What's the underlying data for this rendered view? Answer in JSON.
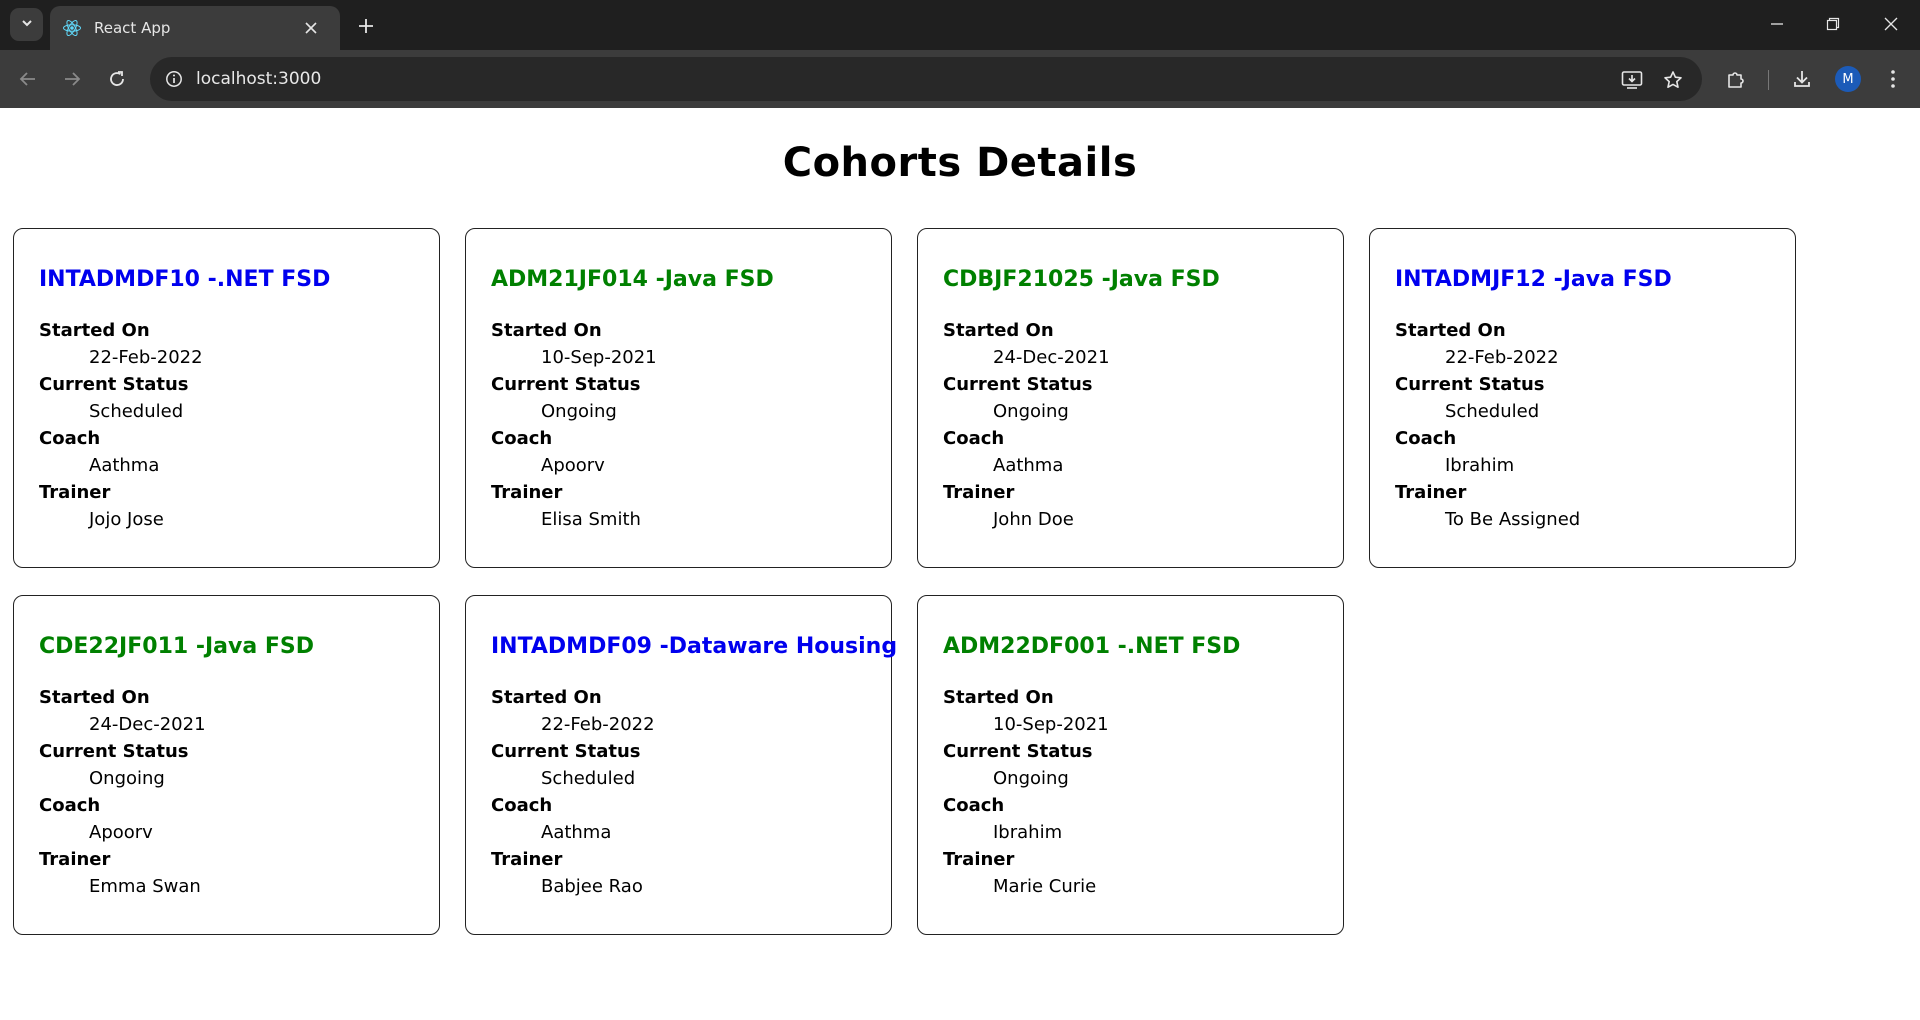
{
  "browser": {
    "tab_title": "React App",
    "url": "localhost:3000",
    "avatar_letter": "M"
  },
  "page": {
    "title": "Cohorts Details"
  },
  "labels": {
    "started_on": "Started On",
    "current_status": "Current Status",
    "coach": "Coach",
    "trainer": "Trainer"
  },
  "colors": {
    "ongoing": "#008000",
    "scheduled": "#0000ee"
  },
  "cohorts": [
    {
      "title": "INTADMDF10 -.NET FSD",
      "started_on": "22-Feb-2022",
      "status": "Scheduled",
      "coach": "Aathma",
      "trainer": "Jojo Jose"
    },
    {
      "title": "ADM21JF014 -Java FSD",
      "started_on": "10-Sep-2021",
      "status": "Ongoing",
      "coach": "Apoorv",
      "trainer": "Elisa Smith"
    },
    {
      "title": "CDBJF21025 -Java FSD",
      "started_on": "24-Dec-2021",
      "status": "Ongoing",
      "coach": "Aathma",
      "trainer": "John Doe"
    },
    {
      "title": "INTADMJF12 -Java FSD",
      "started_on": "22-Feb-2022",
      "status": "Scheduled",
      "coach": "Ibrahim",
      "trainer": "To Be Assigned"
    },
    {
      "title": "CDE22JF011 -Java FSD",
      "started_on": "24-Dec-2021",
      "status": "Ongoing",
      "coach": "Apoorv",
      "trainer": "Emma Swan"
    },
    {
      "title": "INTADMDF09 -Dataware Housing",
      "started_on": "22-Feb-2022",
      "status": "Scheduled",
      "coach": "Aathma",
      "trainer": "Babjee Rao"
    },
    {
      "title": "ADM22DF001 -.NET FSD",
      "started_on": "10-Sep-2021",
      "status": "Ongoing",
      "coach": "Ibrahim",
      "trainer": "Marie Curie"
    }
  ]
}
